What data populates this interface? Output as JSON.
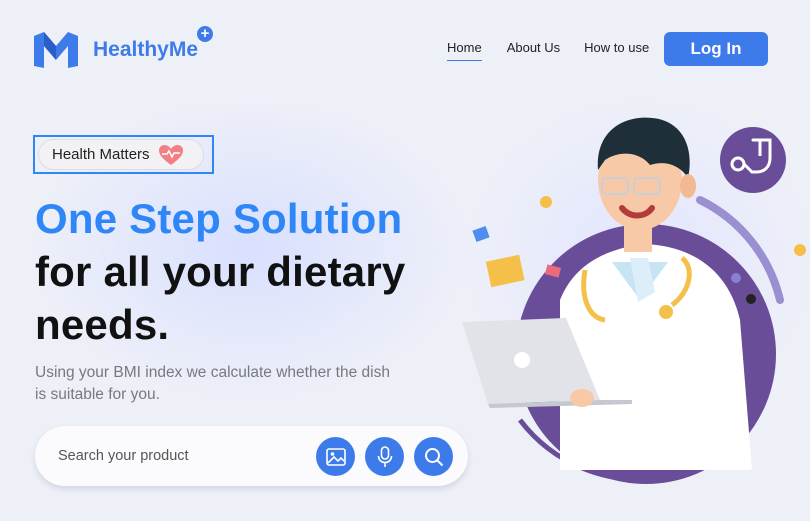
{
  "brand": {
    "name": "HealthyMe",
    "plus": "+",
    "color": "#3e7bea"
  },
  "nav": {
    "home": "Home",
    "about": "About Us",
    "how_to_use": "How to use"
  },
  "login_label": "Log In",
  "hero": {
    "badge": "Health Matters",
    "headline_blue": "One Step Solution",
    "headline_line2": "for all your dietary",
    "headline_line3": "needs.",
    "subtitle": "Using your BMI index we calculate whether the dish is suitable for you."
  },
  "search": {
    "placeholder": "Search your product",
    "value": ""
  },
  "icons": [
    "image-icon",
    "microphone-icon",
    "search-icon",
    "heart-icon",
    "stethoscope-icon"
  ],
  "colors": {
    "accent": "#3e7bea",
    "headline_blue": "#2f86f6",
    "circle": "#6a4d98"
  }
}
